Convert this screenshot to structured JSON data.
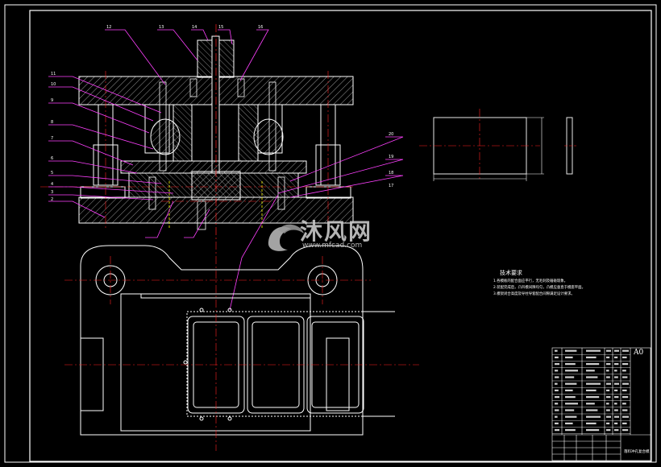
{
  "drawing": {
    "tech_title": "技术要求",
    "tech_notes": [
      "1.各模板的配合面应平行，无毛刺及磕碰现象。",
      "2.装配完成后，凸凹模间隙均匀，凸模应垂直于模座平面。",
      "3.模架闭合高度及导柱导套配合间隙满足设计要求。"
    ],
    "sheet_size": "A0",
    "drawing_name": "落料冲孔复合模",
    "callouts_left": [
      "11",
      "10",
      "9",
      "8",
      "7",
      "6",
      "5",
      "4",
      "3",
      "2"
    ],
    "callouts_top": [
      "12",
      "13",
      "14",
      "15",
      "16"
    ],
    "callouts_right": [
      "20",
      "19",
      "18",
      "17"
    ]
  },
  "watermark": {
    "brand": "沐风网",
    "url": "www.mfcad.com"
  },
  "colors": {
    "background": "#000000",
    "line": "#ffffff",
    "center": "#ff2020",
    "leader": "#ff40ff",
    "hidden": "#ffff00",
    "part_outline": "#e8e8e8"
  }
}
